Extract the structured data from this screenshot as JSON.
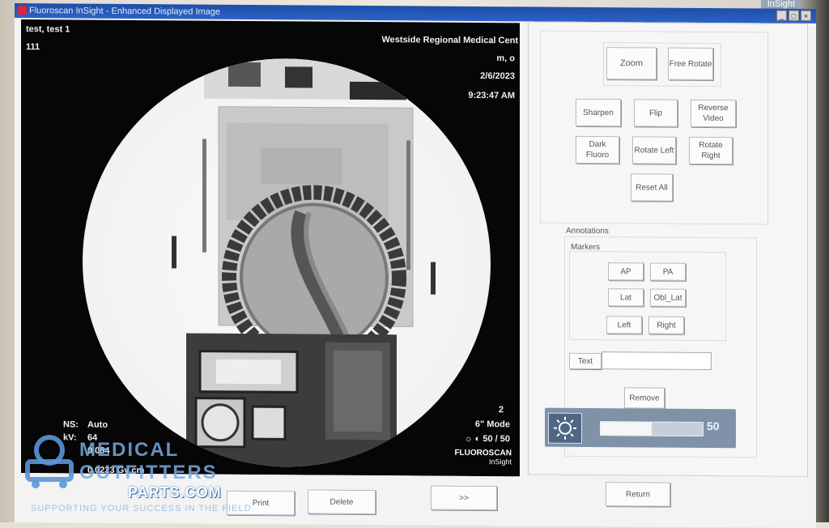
{
  "monitor": {
    "brand": "InSight"
  },
  "window": {
    "title": "Fluoroscan InSight - Enhanced Displayed Image",
    "buttons": [
      "_",
      "□",
      "×"
    ]
  },
  "overlay": {
    "patient_name": "test, test 1",
    "patient_id": "111",
    "institution": "Westside Regional Medical Cent",
    "operator": "m, o",
    "date": "2/6/2023",
    "time": "9:23:47 AM",
    "image_number": "2",
    "mode": "6\" Mode",
    "brightness_contrast": "☼ ◐ 50 / 50",
    "ns_label": "NS:",
    "ns_value": "Auto",
    "kv_label": "kV:",
    "kv_value": "64",
    "ma_value": "0.084",
    "dose_value": "0.0223 Gy cm",
    "logo_line1": "FLUOROSCAN",
    "logo_line2": "InSight"
  },
  "image_tools": {
    "zoom": "Zoom",
    "free_rotate": "Free Rotate",
    "sharpen": "Sharpen",
    "flip": "Flip",
    "reverse_video": "Reverse Video",
    "dark_fluoro": "Dark Fluoro",
    "rotate_left": "Rotate Left",
    "rotate_right": "Rotate Right",
    "reset_all": "Reset All"
  },
  "annotations": {
    "label": "Annotations",
    "markers_label": "Markers",
    "markers": [
      "AP",
      "PA",
      "Lat",
      "Obl_Lat",
      "Left",
      "Right"
    ],
    "text_button": "Text",
    "text_value": "",
    "remove": "Remove"
  },
  "brightness": {
    "value": "50",
    "fraction": 0.5
  },
  "bottom_bar": {
    "print": "Print",
    "delete": "Delete",
    "next": ">>",
    "return": "Return"
  },
  "watermark": {
    "line1": "MEDICAL",
    "line2": "OUTFITTERS",
    "line3": "PARTS.COM",
    "tagline": "SUPPORTING YOUR SUCCESS IN THE FIELD"
  }
}
